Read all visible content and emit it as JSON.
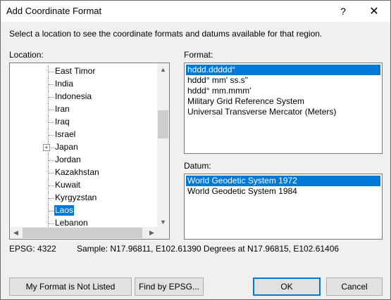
{
  "window": {
    "title": "Add Coordinate Format",
    "help_glyph": "?",
    "close_glyph": "✕"
  },
  "instruction": "Select a location to see the coordinate formats and datums available for that region.",
  "location": {
    "label": "Location:",
    "items": [
      {
        "label": "East Timor",
        "selected": false,
        "expandable": false
      },
      {
        "label": "India",
        "selected": false,
        "expandable": false
      },
      {
        "label": "Indonesia",
        "selected": false,
        "expandable": false
      },
      {
        "label": "Iran",
        "selected": false,
        "expandable": false
      },
      {
        "label": "Iraq",
        "selected": false,
        "expandable": false
      },
      {
        "label": "Israel",
        "selected": false,
        "expandable": false
      },
      {
        "label": "Japan",
        "selected": false,
        "expandable": true
      },
      {
        "label": "Jordan",
        "selected": false,
        "expandable": false
      },
      {
        "label": "Kazakhstan",
        "selected": false,
        "expandable": false
      },
      {
        "label": "Kuwait",
        "selected": false,
        "expandable": false
      },
      {
        "label": "Kyrgyzstan",
        "selected": false,
        "expandable": false
      },
      {
        "label": "Laos",
        "selected": true,
        "expandable": false
      },
      {
        "label": "Lebanon",
        "selected": false,
        "expandable": false
      }
    ]
  },
  "format": {
    "label": "Format:",
    "items": [
      {
        "label": "hddd.ddddd°",
        "selected": true
      },
      {
        "label": "hddd° mm' ss.s\"",
        "selected": false
      },
      {
        "label": "hddd° mm.mmm'",
        "selected": false
      },
      {
        "label": "Military Grid Reference System",
        "selected": false
      },
      {
        "label": "Universal Transverse Mercator (Meters)",
        "selected": false
      }
    ]
  },
  "datum": {
    "label": "Datum:",
    "items": [
      {
        "label": "World Geodetic System 1972",
        "selected": true
      },
      {
        "label": "World Geodetic System 1984",
        "selected": false
      }
    ]
  },
  "status": {
    "epsg": "EPSG: 4322",
    "sample": "Sample: N17.96811, E102.61390 Degrees at N17.96815, E102.61406"
  },
  "buttons": {
    "not_listed": "My Format is Not Listed",
    "find_epsg": "Find by EPSG...",
    "ok": "OK",
    "cancel": "Cancel"
  },
  "colors": {
    "selection": "#0078d7",
    "dialog_bg": "#f0f0f0"
  }
}
